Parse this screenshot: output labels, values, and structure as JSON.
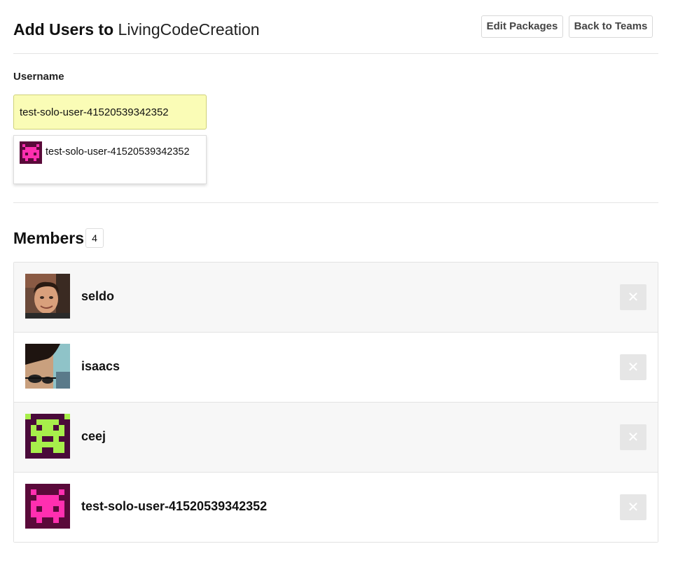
{
  "header": {
    "title_prefix": "Add Users to",
    "team_name": "LivingCodeCreation",
    "edit_packages_label": "Edit Packages",
    "back_to_teams_label": "Back to Teams"
  },
  "form": {
    "username_label": "Username",
    "username_value": "test-solo-user-41520539342352"
  },
  "suggestions": [
    {
      "name": "test-solo-user-41520539342352",
      "avatar": "pink-invader-icon"
    }
  ],
  "members": {
    "title": "Members",
    "count": "4",
    "items": [
      {
        "name": "seldo",
        "avatar": "photo-avatar",
        "remove_label": "✕"
      },
      {
        "name": "isaacs",
        "avatar": "photo-avatar",
        "remove_label": "✕"
      },
      {
        "name": "ceej",
        "avatar": "green-invader-icon",
        "remove_label": "✕"
      },
      {
        "name": "test-solo-user-41520539342352",
        "avatar": "pink-invader-icon",
        "remove_label": "✕"
      }
    ]
  },
  "colors": {
    "input_bg": "#fafcb6",
    "row_alt_bg": "#f7f7f7",
    "remove_btn_bg": "#e6e6e6",
    "pink_invader": "#ff2fb0",
    "green_invader": "#a7ee4b",
    "invader_bg": "#5a0a3a"
  }
}
